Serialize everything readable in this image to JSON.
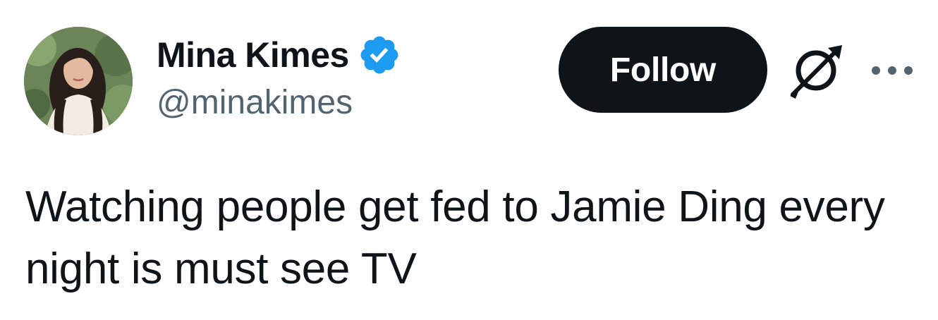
{
  "author": {
    "display_name": "Mina Kimes",
    "handle": "@minakimes",
    "verified": true,
    "verified_badge_color": "#1d9bf0",
    "avatar_icon": "profile-photo"
  },
  "actions": {
    "follow_label": "Follow",
    "grok_icon": "grok-icon",
    "more_icon": "more-options-icon"
  },
  "tweet": {
    "text": "Watching people get fed to Jamie Ding every night is must see TV"
  },
  "colors": {
    "text_primary": "#0f1419",
    "text_secondary": "#536471",
    "button_bg": "#0f1419",
    "button_text": "#ffffff",
    "accent": "#1d9bf0"
  }
}
